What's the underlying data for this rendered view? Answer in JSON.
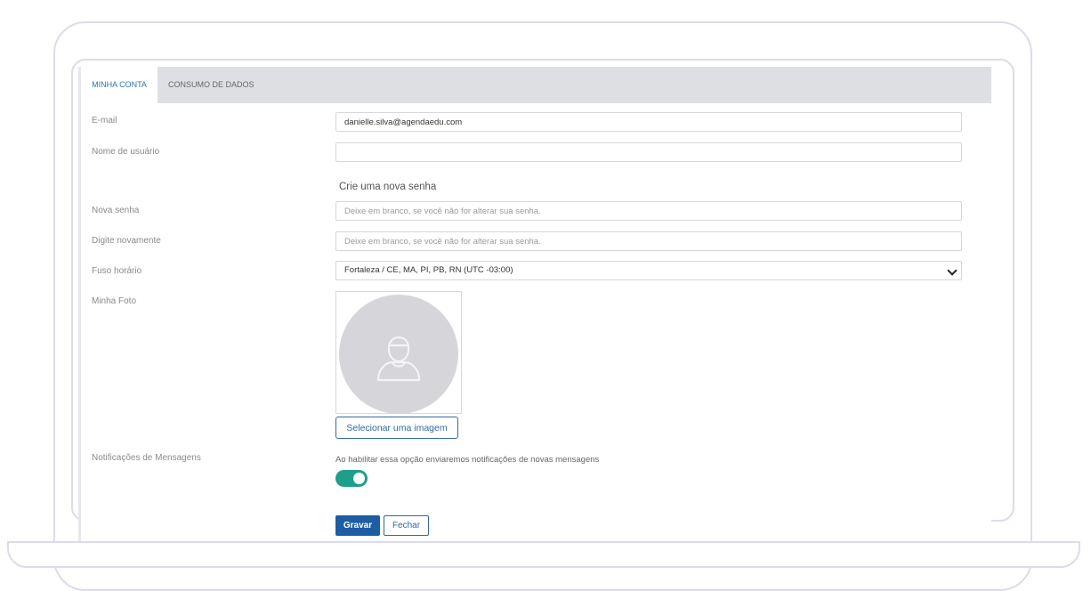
{
  "tabs": [
    {
      "label": "MINHA CONTA"
    },
    {
      "label": "CONSUMO DE DADOS"
    }
  ],
  "form": {
    "email": {
      "label": "E-mail",
      "value": "danielle.silva@agendaedu.com"
    },
    "username": {
      "label": "Nome de usuário",
      "value": ""
    },
    "password_section_title": "Crie uma nova senha",
    "new_password": {
      "label": "Nova senha",
      "placeholder": "Deixe em branco, se você não for alterar sua senha."
    },
    "confirm_password": {
      "label": "Digite novamente",
      "placeholder": "Deixe em branco, se você não for alterar sua senha."
    },
    "timezone": {
      "label": "Fuso horário",
      "value": "Fortaleza / CE, MA, PI, PB, RN (UTC -03:00)"
    },
    "photo": {
      "label": "Minha Foto",
      "button_label": "Selecionar uma imagem",
      "icon": "user-placeholder-icon"
    },
    "notifications": {
      "label": "Notificações de Mensagens",
      "help": "Ao habilitar essa opção enviaremos notificações de novas mensagens",
      "enabled": true
    }
  },
  "actions": {
    "save_label": "Gravar",
    "close_label": "Fechar"
  },
  "colors": {
    "accent": "#1c5da3",
    "toggle_on": "#1f9e8c",
    "tab_bar": "#dedfe3"
  }
}
